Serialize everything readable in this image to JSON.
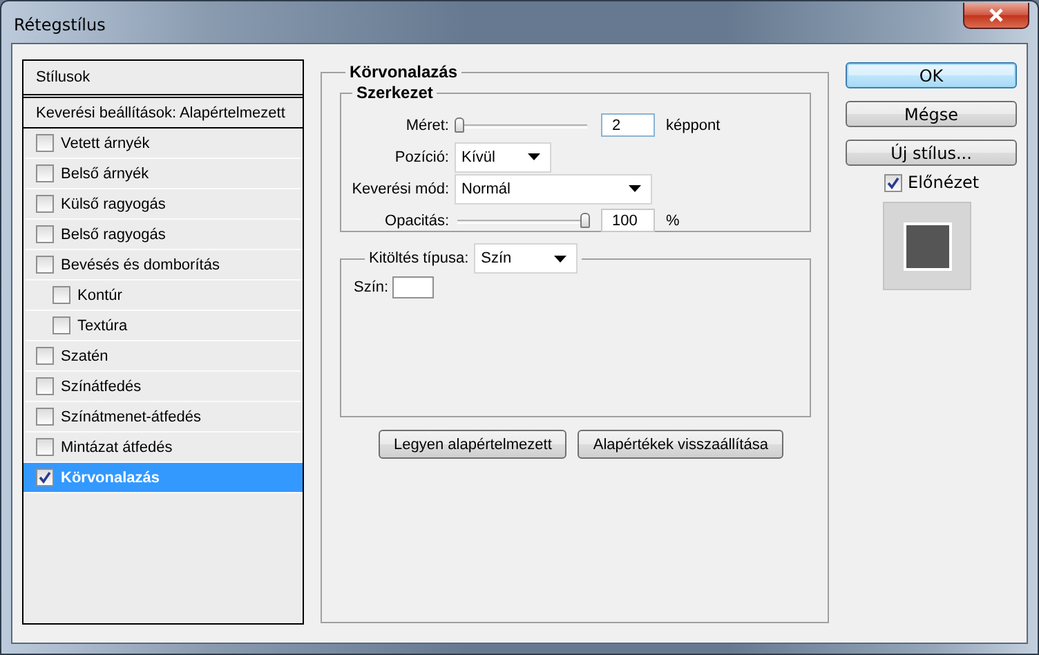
{
  "window": {
    "title": "Rétegstílus"
  },
  "sidebar": {
    "header": "Stílusok",
    "blend_item": {
      "label": "Keverési beállítások: Alapértelmezett",
      "selected": false
    },
    "items": [
      {
        "label": "Vetett árnyék",
        "checked": false,
        "selected": false
      },
      {
        "label": "Belső árnyék",
        "checked": false,
        "selected": false
      },
      {
        "label": "Külső ragyogás",
        "checked": false,
        "selected": false
      },
      {
        "label": "Belső ragyogás",
        "checked": false,
        "selected": false
      },
      {
        "label": "Bevésés és domborítás",
        "checked": false,
        "selected": false,
        "children": [
          {
            "label": "Kontúr",
            "checked": false,
            "selected": false
          },
          {
            "label": "Textúra",
            "checked": false,
            "selected": false
          }
        ]
      },
      {
        "label": "Szatén",
        "checked": false,
        "selected": false
      },
      {
        "label": "Színátfedés",
        "checked": false,
        "selected": false
      },
      {
        "label": "Színátmenet-átfedés",
        "checked": false,
        "selected": false
      },
      {
        "label": "Mintázat átfedés",
        "checked": false,
        "selected": false
      },
      {
        "label": "Körvonalazás",
        "checked": true,
        "selected": true
      }
    ]
  },
  "stroke": {
    "title": "Körvonalazás",
    "structure": {
      "title": "Szerkezet",
      "size": {
        "label": "Méret:",
        "level": 0.0,
        "value": "2",
        "unit": "képpont"
      },
      "position": {
        "label": "Pozíció:",
        "value": "Kívül"
      },
      "blend_mode": {
        "label": "Keverési mód:",
        "value": "Normál"
      },
      "opacity": {
        "label": "Opacitás:",
        "level": 1.0,
        "value": "100",
        "unit": "%"
      }
    },
    "fill": {
      "label": "Kitöltés típusa:",
      "value": "Szín",
      "color_label": "Szín:"
    },
    "buttons": [
      "Legyen alapértelmezett",
      "Alapértékek visszaállítása"
    ]
  },
  "actions": {
    "buttons": [
      {
        "label": "OK",
        "default": true
      },
      {
        "label": "Mégse",
        "default": false
      },
      {
        "label": "Új stílus...",
        "default": false
      }
    ],
    "preview": {
      "label": "Előnézet",
      "checked": true
    }
  }
}
